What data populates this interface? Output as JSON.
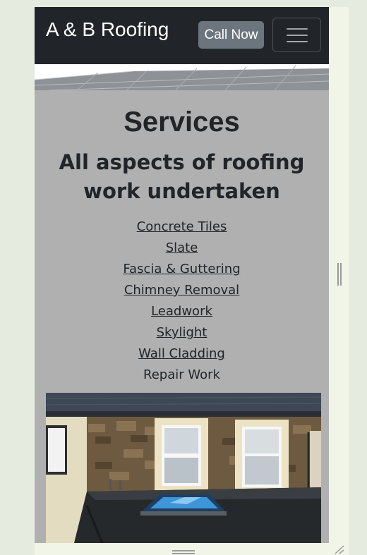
{
  "navbar": {
    "brand": "A & B Roofing",
    "call_button": "Call Now",
    "menu_toggle_icon": "hamburger-icon"
  },
  "services": {
    "title": "Services",
    "subtitle": "All aspects of roofing work undertaken",
    "items": [
      {
        "label": "Concrete Tiles",
        "linked": true
      },
      {
        "label": "Slate",
        "linked": true
      },
      {
        "label": "Fascia & Guttering",
        "linked": true
      },
      {
        "label": "Chimney Removal",
        "linked": true
      },
      {
        "label": "Leadwork",
        "linked": true
      },
      {
        "label": "Skylight",
        "linked": true
      },
      {
        "label": "Wall Cladding",
        "linked": true
      },
      {
        "label": "Repair Work",
        "linked": false
      }
    ]
  },
  "colors": {
    "navbar_bg": "#212529",
    "call_button_bg": "#6c757d",
    "page_bg": "#b0b0b0",
    "text": "#212529"
  }
}
